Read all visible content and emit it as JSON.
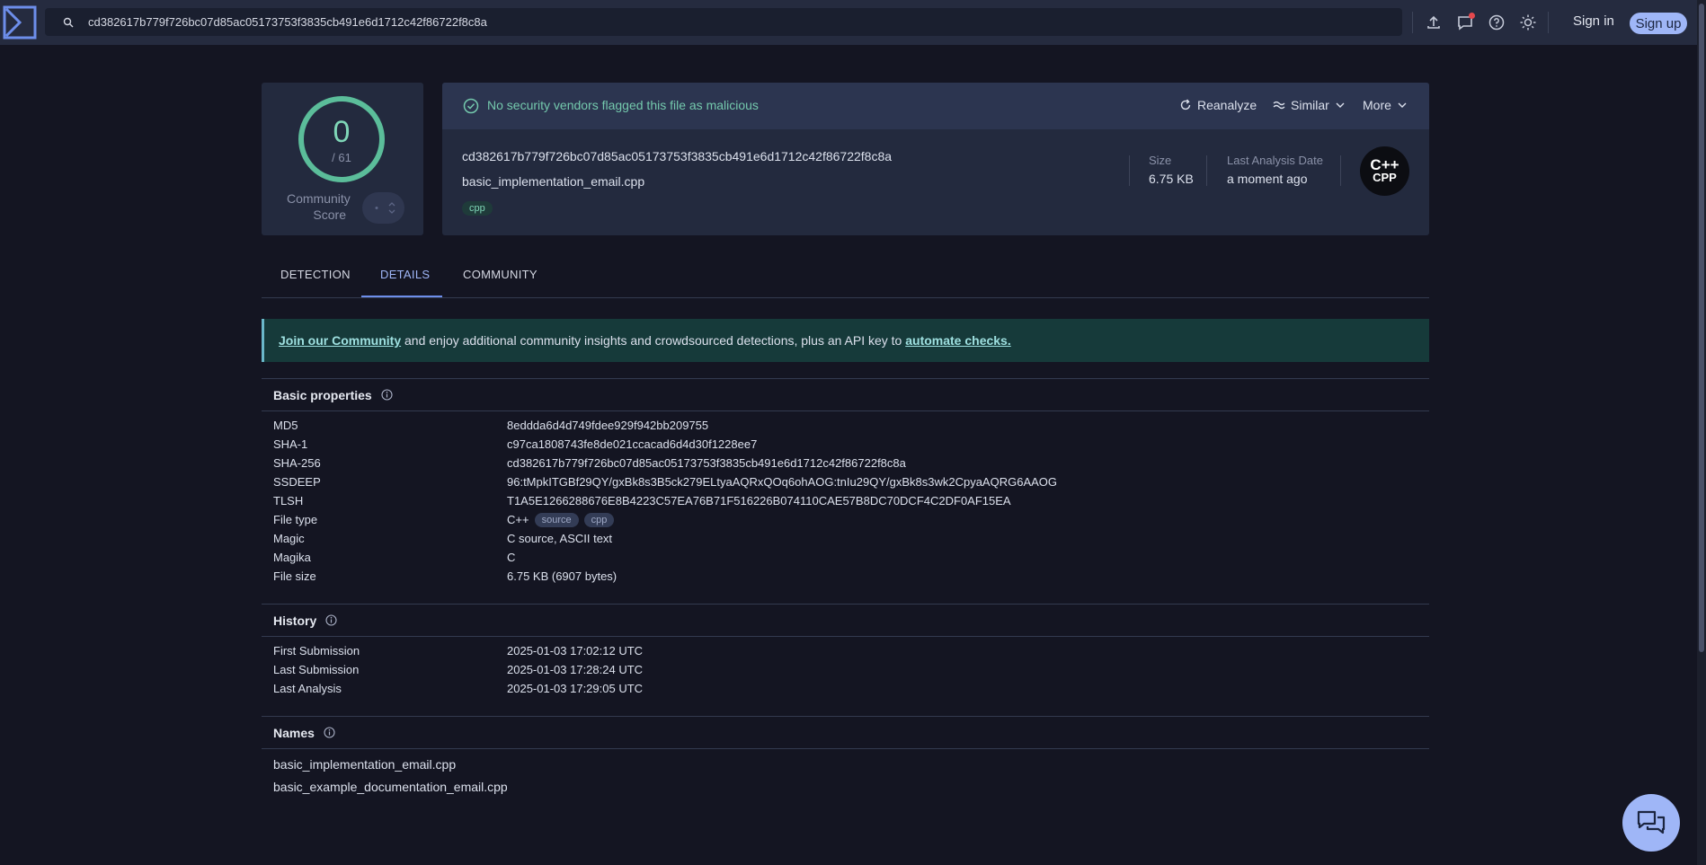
{
  "topbar": {
    "search_value": "cd382617b779f726bc07d85ac05173753f3835cb491e6d1712c42f86722f8c8a",
    "signin_label": "Sign in",
    "signup_label": "Sign up"
  },
  "score": {
    "detections": "0",
    "total": "/ 61",
    "community_label_1": "Community",
    "community_label_2": "Score"
  },
  "header": {
    "status_text": "No security vendors flagged this file as malicious",
    "reanalyze_label": "Reanalyze",
    "similar_label": "Similar",
    "more_label": "More",
    "file_hash": "cd382617b779f726bc07d85ac05173753f3835cb491e6d1712c42f86722f8c8a",
    "file_name": "basic_implementation_email.cpp",
    "file_tag": "cpp",
    "size_label": "Size",
    "size_value": "6.75 KB",
    "last_analysis_label": "Last Analysis Date",
    "last_analysis_value": "a moment ago",
    "filetype_badge_top": "C++",
    "filetype_badge_bottom": "CPP"
  },
  "tabs": [
    {
      "label": "DETECTION"
    },
    {
      "label": "DETAILS"
    },
    {
      "label": "COMMUNITY"
    }
  ],
  "banner": {
    "link1": "Join our Community",
    "middle": " and enjoy additional community insights and crowdsourced detections, plus an API key to ",
    "link2": "automate checks."
  },
  "basic_properties": {
    "title": "Basic properties",
    "rows": [
      {
        "key": "MD5",
        "value": "8eddda6d4d749fdee929f942bb209755"
      },
      {
        "key": "SHA-1",
        "value": "c97ca1808743fe8de021ccacad6d4d30f1228ee7"
      },
      {
        "key": "SHA-256",
        "value": "cd382617b779f726bc07d85ac05173753f3835cb491e6d1712c42f86722f8c8a"
      },
      {
        "key": "SSDEEP",
        "value": "96:tMpkITGBf29QY/gxBk8s3B5ck279ELtyaAQRxQOq6ohAOG:tnIu29QY/gxBk8s3wk2CpyaAQRG6AAOG"
      },
      {
        "key": "TLSH",
        "value": "T1A5E1266288676E8B4223C57EA76B71F516226B074110CAE57B8DC70DCF4C2DF0AF15EA"
      },
      {
        "key": "File type",
        "value": "C++",
        "tags": [
          "source",
          "cpp"
        ]
      },
      {
        "key": "Magic",
        "value": "C source, ASCII text"
      },
      {
        "key": "Magika",
        "value": "C"
      },
      {
        "key": "File size",
        "value": "6.75 KB (6907 bytes)"
      }
    ]
  },
  "history": {
    "title": "History",
    "rows": [
      {
        "key": "First Submission",
        "value": "2025-01-03 17:02:12 UTC"
      },
      {
        "key": "Last Submission",
        "value": "2025-01-03 17:28:24 UTC"
      },
      {
        "key": "Last Analysis",
        "value": "2025-01-03 17:29:05 UTC"
      }
    ]
  },
  "names": {
    "title": "Names",
    "items": [
      "basic_implementation_email.cpp",
      "basic_example_documentation_email.cpp"
    ]
  },
  "colors": {
    "background": "#141522",
    "topbar": "#252b3f",
    "card": "#232a3e",
    "accent": "#9fb6f7",
    "ok_green": "#74c9ad",
    "banner": "#163a3a"
  }
}
